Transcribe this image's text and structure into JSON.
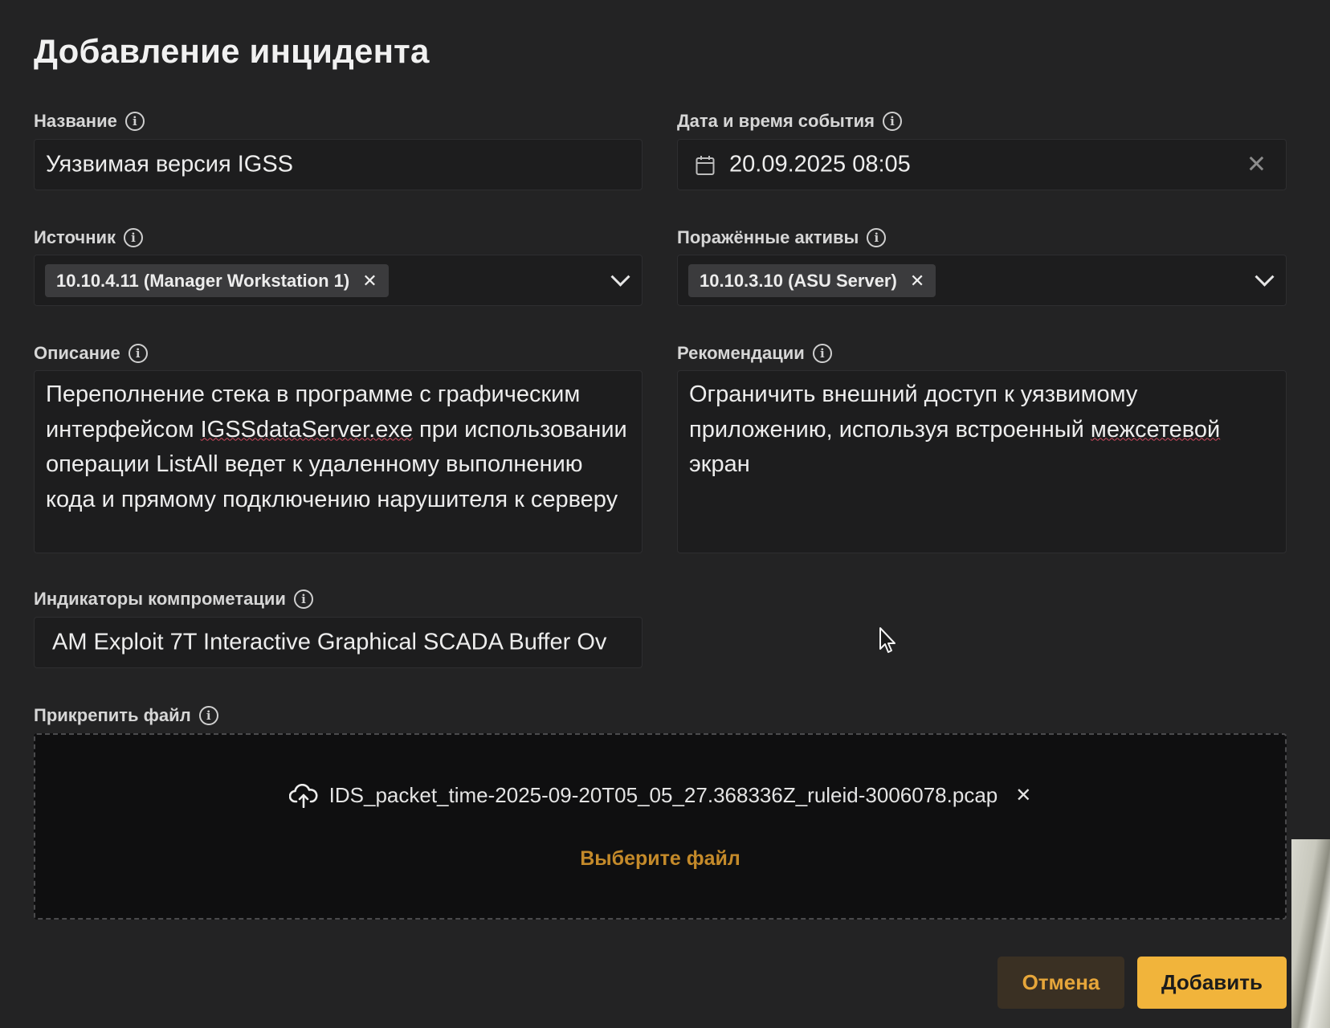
{
  "dialog": {
    "title": "Добавление инцидента"
  },
  "fields": {
    "name": {
      "label": "Название",
      "value": "Уязвимая версия IGSS"
    },
    "datetime": {
      "label": "Дата и время события",
      "value": "20.09.2025 08:05"
    },
    "source": {
      "label": "Источник",
      "tag": "10.10.4.11 (Manager Workstation 1)"
    },
    "assets": {
      "label": "Поражённые активы",
      "tag": "10.10.3.10 (ASU Server)"
    },
    "description": {
      "label": "Описание",
      "value_before": "Переполнение стека в программе с графическим интерфейсом ",
      "value_misspelled": "IGSSdataServer.exe",
      "value_after": " при использовании операции ListAll ведет к удаленному выполнению кода и прямому подключению нарушителя к серверу"
    },
    "recommendations": {
      "label": "Рекомендации",
      "value_before": "Ограничить внешний доступ к уязвимому приложению, используя встроенный ",
      "value_misspelled": "межсетевой",
      "value_after": " экран"
    },
    "ioc": {
      "label": "Индикаторы компрометации",
      "value": "AM Exploit 7T Interactive Graphical SCADA Buffer Ov"
    },
    "attachment": {
      "label": "Прикрепить файл",
      "file_name": "IDS_packet_time-2025-09-20T05_05_27.368336Z_ruleid-3006078.pcap",
      "choose_label": "Выберите файл"
    }
  },
  "buttons": {
    "cancel": "Отмена",
    "add": "Добавить"
  },
  "icons": {
    "info": "info-icon",
    "calendar": "calendar-icon",
    "clear": "close-icon",
    "chevron": "chevron-down-icon",
    "upload": "cloud-upload-icon"
  },
  "colors": {
    "background": "#232324",
    "accent": "#f1b43b",
    "link": "#c48a2a"
  }
}
